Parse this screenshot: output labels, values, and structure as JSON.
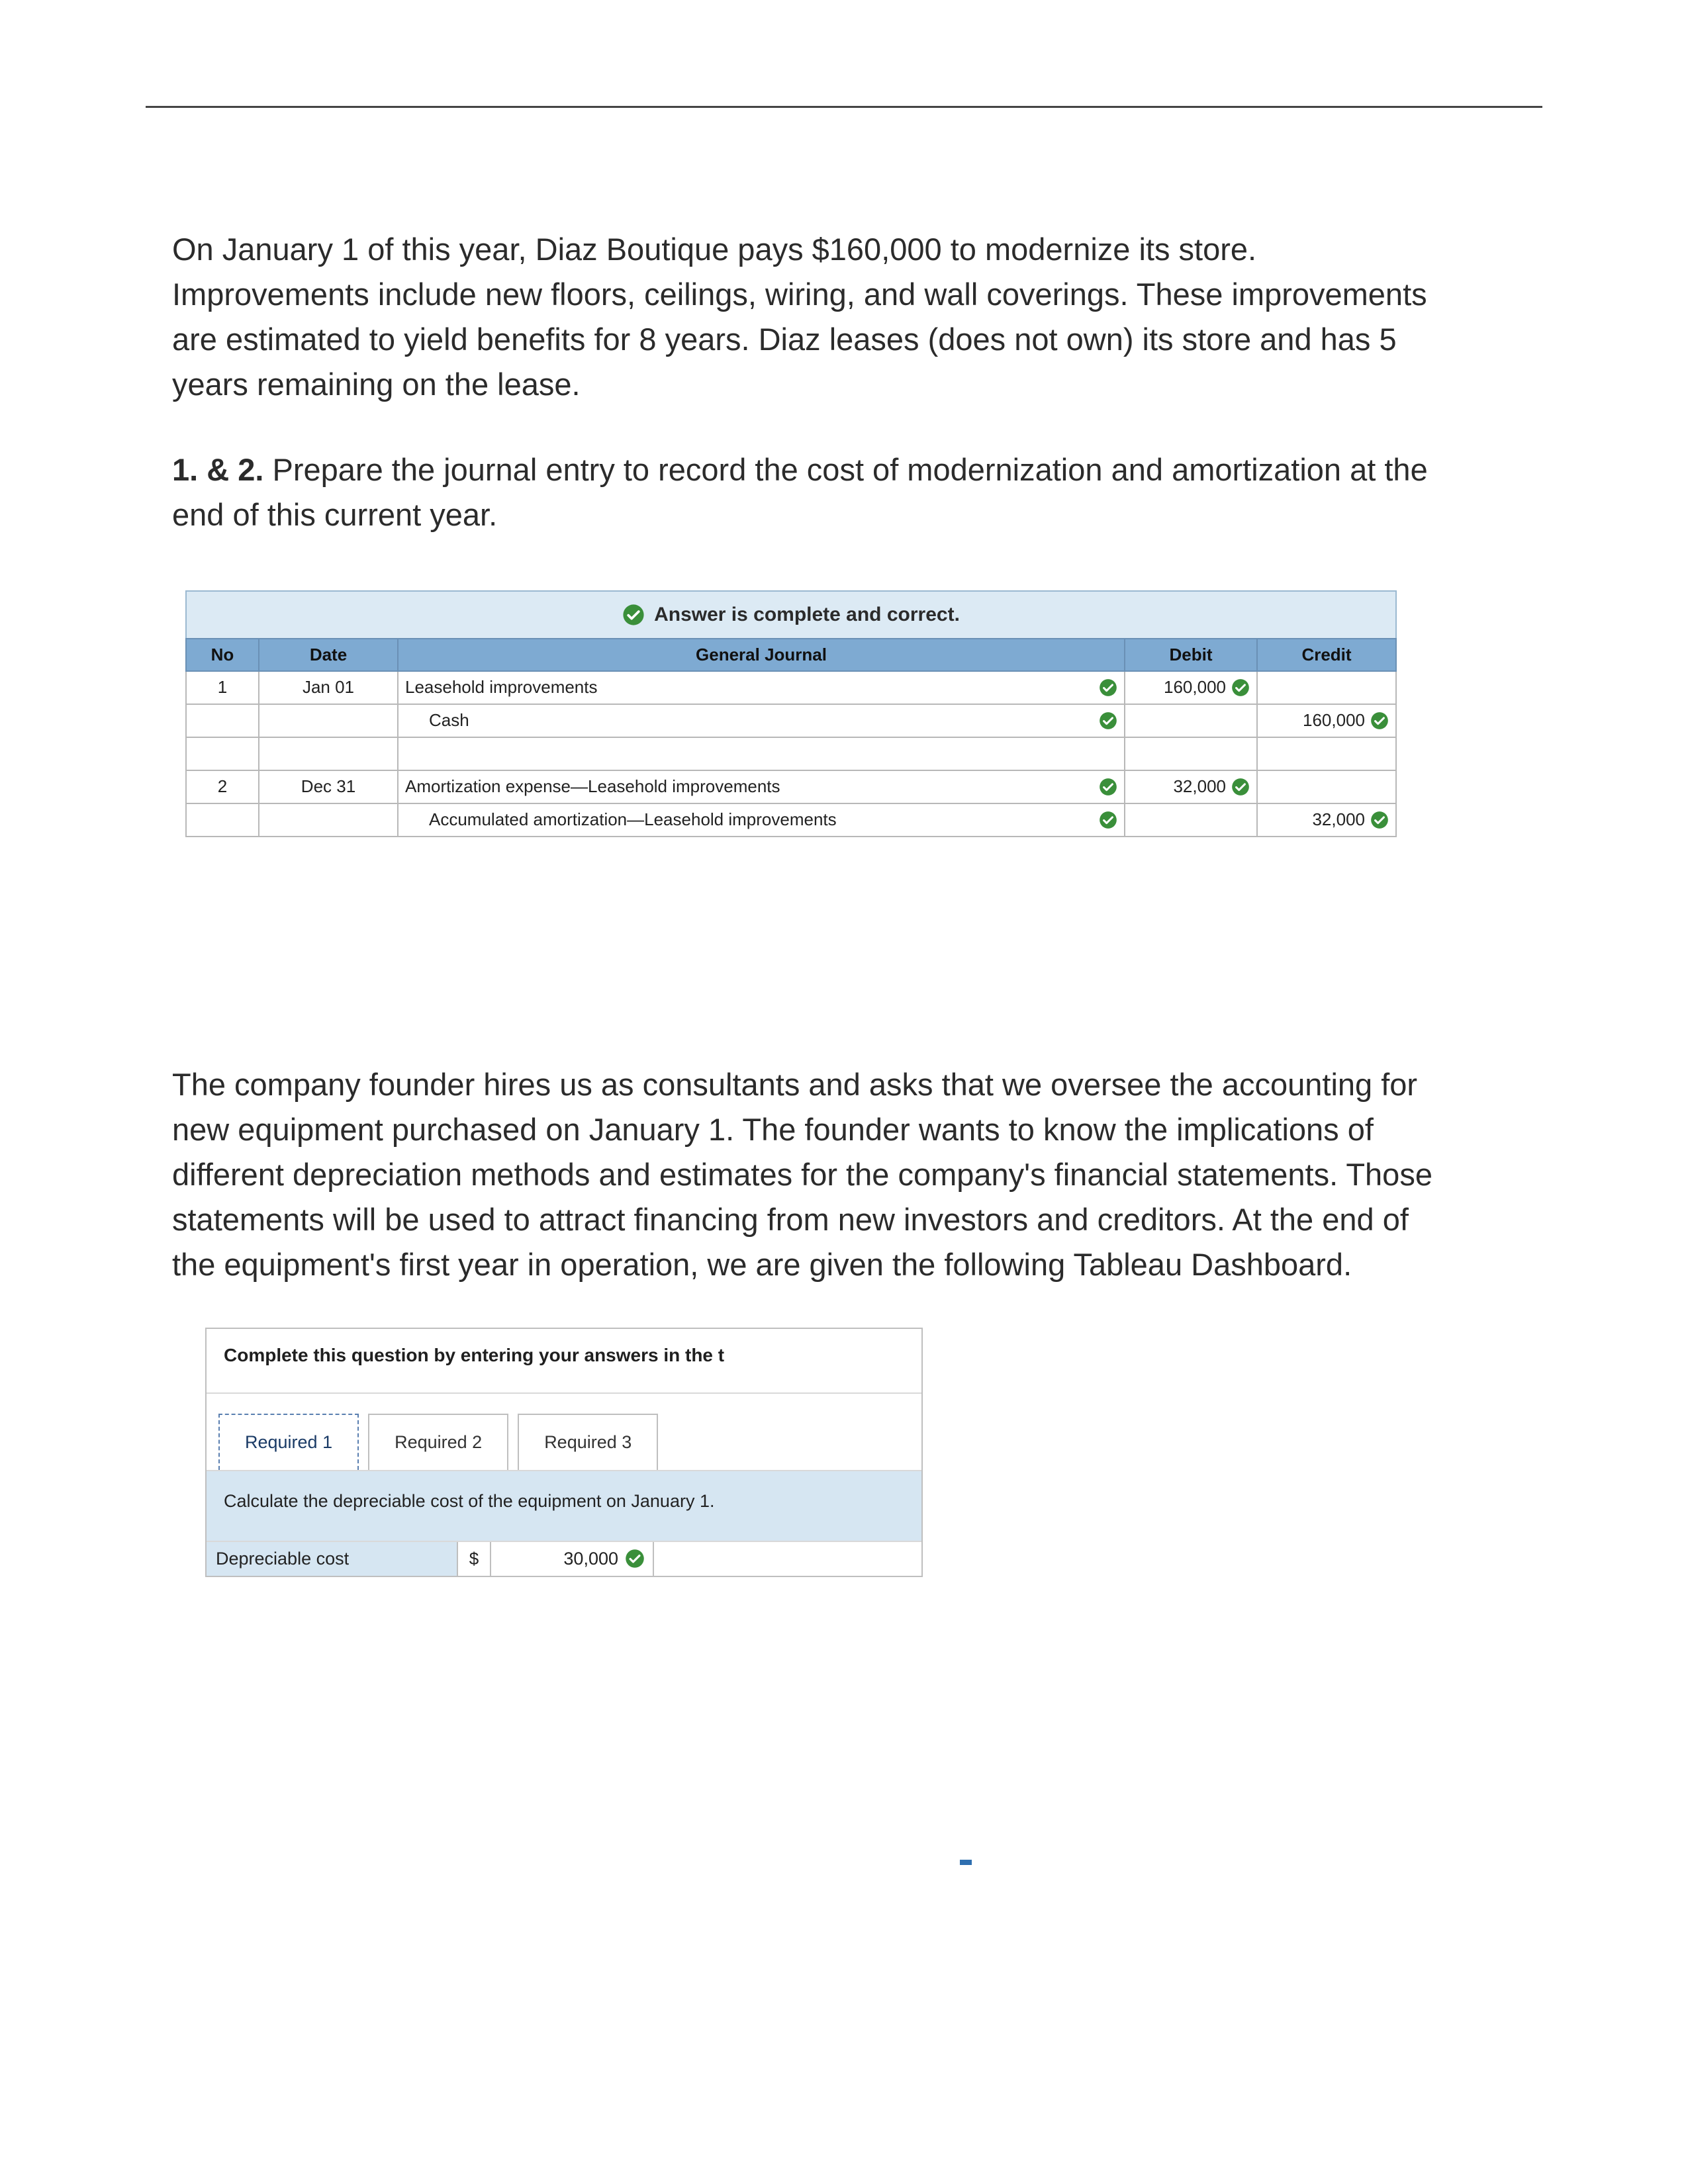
{
  "problem1": {
    "paragraph": "On January 1 of this year, Diaz Boutique pays $160,000 to modernize its store. Improvements include new floors, ceilings, wiring, and wall coverings. These improvements are estimated to yield benefits for 8 years. Diaz leases (does not own) its store and has 5 years remaining on the lease.",
    "task_prefix": "1. & 2. ",
    "task": "Prepare the journal entry to record the cost of modernization and amortization at the end of this current year.",
    "status": "Answer is complete and correct.",
    "headers": {
      "no": "No",
      "date": "Date",
      "gj": "General Journal",
      "debit": "Debit",
      "credit": "Credit"
    },
    "rows": [
      {
        "no": "1",
        "date": "Jan 01",
        "account": "Leasehold improvements",
        "indent": false,
        "check": true,
        "debit": "160,000",
        "credit": ""
      },
      {
        "no": "",
        "date": "",
        "account": "Cash",
        "indent": true,
        "check": true,
        "debit": "",
        "credit": "160,000"
      },
      {
        "no": "",
        "date": "",
        "account": "",
        "indent": false,
        "check": false,
        "debit": "",
        "credit": ""
      },
      {
        "no": "2",
        "date": "Dec 31",
        "account": "Amortization expense—Leasehold improvements",
        "indent": false,
        "check": true,
        "debit": "32,000",
        "credit": ""
      },
      {
        "no": "",
        "date": "",
        "account": "Accumulated amortization—Leasehold improvements",
        "indent": true,
        "check": true,
        "debit": "",
        "credit": "32,000"
      }
    ]
  },
  "problem2": {
    "paragraph": "The company founder hires us as consultants and asks that we oversee the accounting for new equipment purchased on January 1. The founder wants to know the implications of different depreciation methods and estimates for the company's financial statements. Those statements will be used to attract financing from new investors and creditors. At the end of the equipment's first year in operation, we are given the following Tableau Dashboard.",
    "header": "Complete this question by entering your answers in the t",
    "tabs": [
      "Required 1",
      "Required 2",
      "Required 3"
    ],
    "instruction": "Calculate the depreciable cost of the equipment on January 1.",
    "answer_label": "Depreciable cost",
    "currency": "$",
    "answer_value": "30,000"
  }
}
